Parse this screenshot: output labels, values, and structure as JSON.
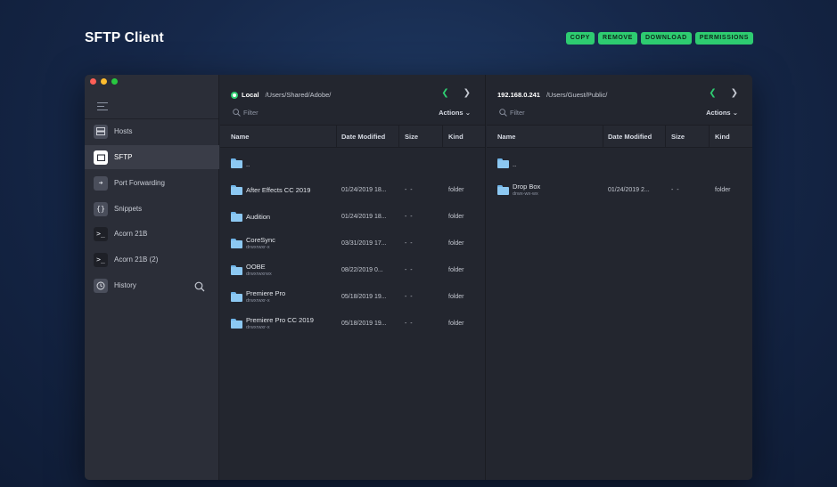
{
  "app": {
    "title": "SFTP Client",
    "actions": [
      "COPY",
      "REMOVE",
      "DOWNLOAD",
      "PERMISSIONS"
    ]
  },
  "colors": {
    "accent": "#2ecc71",
    "window_bg": "#23262f",
    "sidebar_bg": "#2b2e38",
    "folder": "#8cc8f2",
    "traffic_close": "#ff5f57",
    "traffic_min": "#febc2e",
    "traffic_max": "#28c840"
  },
  "sidebar": {
    "items": [
      {
        "label": "Hosts",
        "icon": "server-icon"
      },
      {
        "label": "SFTP",
        "icon": "folder-icon",
        "active": true
      },
      {
        "label": "Port Forwarding",
        "icon": "forward-icon"
      },
      {
        "label": "Snippets",
        "icon": "braces-icon"
      },
      {
        "label": "Acorn 21B",
        "icon": "terminal-icon"
      },
      {
        "label": "Acorn 21B (2)",
        "icon": "terminal-icon"
      },
      {
        "label": "History",
        "icon": "clock-icon"
      }
    ]
  },
  "local": {
    "host": "Local",
    "path": "/Users/Shared/Adobe/",
    "filter_placeholder": "Filter",
    "actions_label": "Actions",
    "columns": [
      "Name",
      "Date Modified",
      "Size",
      "Kind"
    ],
    "rows": [
      {
        "name": "..",
        "sub": "",
        "date": "",
        "size": "",
        "kind": ""
      },
      {
        "name": "After Effects CC 2019",
        "sub": "",
        "date": "01/24/2019 18...",
        "size": "- -",
        "kind": "folder"
      },
      {
        "name": "Audition",
        "sub": "",
        "date": "01/24/2019 18...",
        "size": "- -",
        "kind": "folder"
      },
      {
        "name": "CoreSync",
        "sub": "drwxrwxr-x",
        "date": "03/31/2019 17...",
        "size": "- -",
        "kind": "folder"
      },
      {
        "name": "OOBE",
        "sub": "drwxrwxrwx",
        "date": "08/22/2019 0...",
        "size": "- -",
        "kind": "folder"
      },
      {
        "name": "Premiere Pro",
        "sub": "drwxrwxr-x",
        "date": "05/18/2019 19...",
        "size": "- -",
        "kind": "folder"
      },
      {
        "name": "Premiere Pro CC 2019",
        "sub": "drwxrwxr-x",
        "date": "05/18/2019 19...",
        "size": "- -",
        "kind": "folder"
      }
    ]
  },
  "remote": {
    "host": "192.168.0.241",
    "path": "/Users/Guest/Public/",
    "filter_placeholder": "Filter",
    "actions_label": "Actions",
    "columns": [
      "Name",
      "Date Modified",
      "Size",
      "Kind"
    ],
    "rows": [
      {
        "name": "..",
        "sub": "",
        "date": "",
        "size": "",
        "kind": ""
      },
      {
        "name": "Drop Box",
        "sub": "drwx-wx-wx",
        "date": "01/24/2019 2...",
        "size": "- -",
        "kind": "folder"
      }
    ]
  }
}
